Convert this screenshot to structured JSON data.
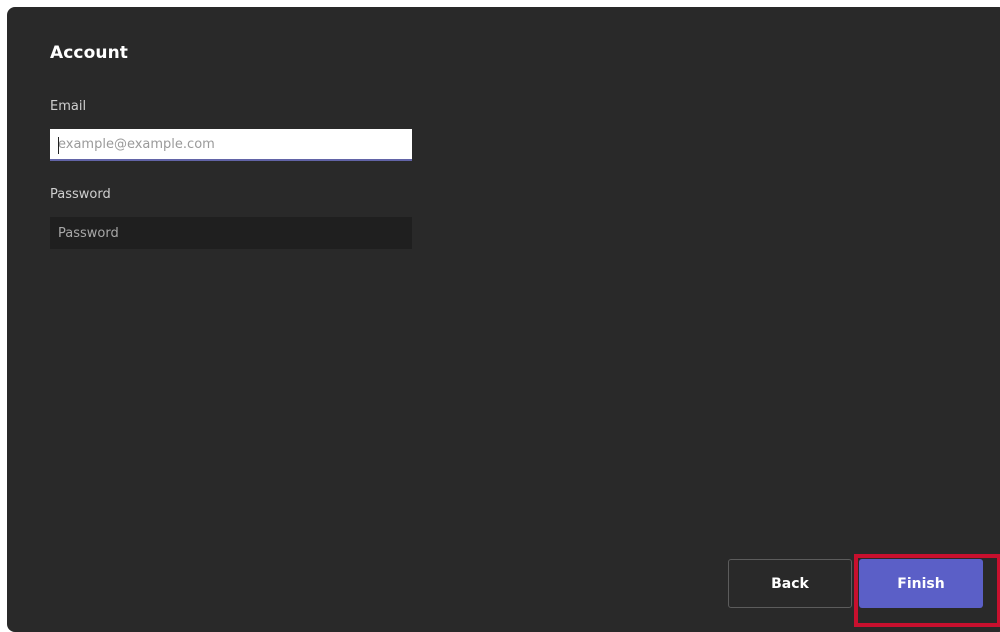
{
  "account": {
    "title": "Account",
    "email_label": "Email",
    "email_placeholder": "example@example.com",
    "email_value": "",
    "password_label": "Password",
    "password_placeholder": "Password",
    "password_value": ""
  },
  "footer": {
    "back_label": "Back",
    "finish_label": "Finish"
  },
  "colors": {
    "panel_background": "#292929",
    "accent": "#5b5fc7",
    "highlight": "#c8102e"
  }
}
